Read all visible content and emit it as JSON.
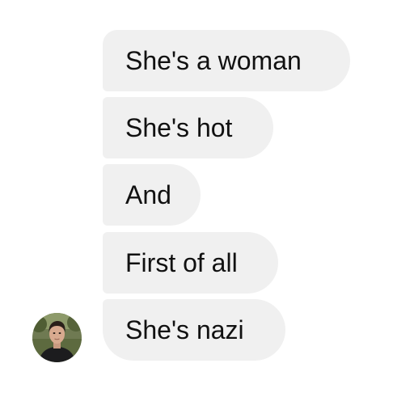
{
  "thread": {
    "messages": [
      {
        "text": "She's a woman"
      },
      {
        "text": "She's hot"
      },
      {
        "text": "And"
      },
      {
        "text": "First of all"
      },
      {
        "text": "She's nazi"
      }
    ]
  },
  "colors": {
    "bubble_background": "#f0f0f0",
    "text": "#111111",
    "page_background": "#ffffff"
  },
  "avatar": {
    "icon": "profile-photo"
  }
}
